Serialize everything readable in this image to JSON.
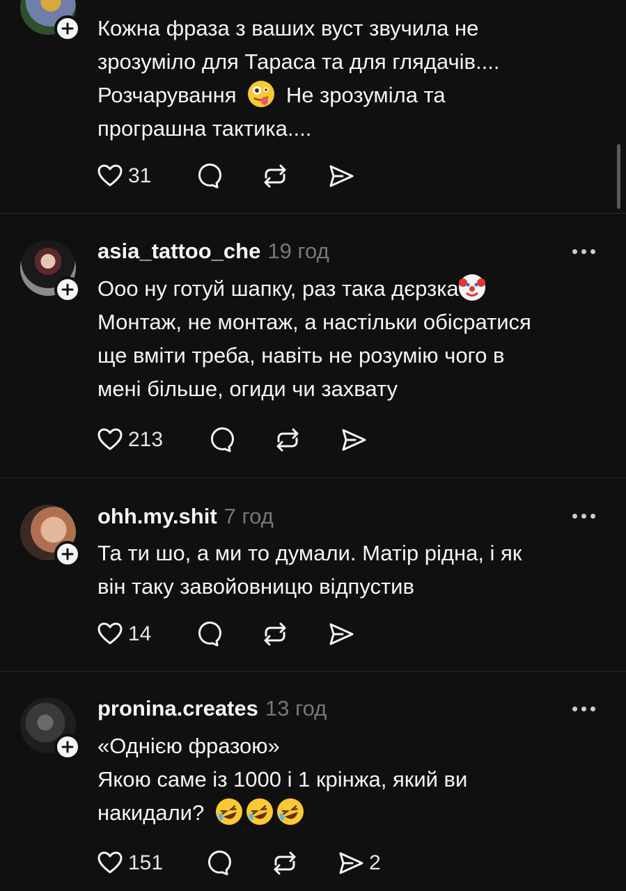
{
  "posts": [
    {
      "username": "",
      "time": "",
      "lines": [
        "Кожна фраза з ваших вуст звучила не",
        "зрозуміло для Тараса та для глядачів....",
        "Розчарування",
        "Не зрозуміла та",
        "програшна тактика...."
      ],
      "likes": "31",
      "shares": ""
    },
    {
      "username": "asia_tattoo_che",
      "time": "19 год",
      "lines": [
        "Ооо ну готуй шапку, раз така дєрзка",
        "Монтаж, не монтаж, а настільки обісратися",
        "ще вміти треба, навіть не розумію чого в",
        "мені більше, огиди чи захвату"
      ],
      "likes": "213",
      "shares": ""
    },
    {
      "username": "ohh.my.shit",
      "time": "7 год",
      "lines": [
        "Та ти шо, а ми то думали. Матір рідна, і як",
        "він таку завойовницю відпустив"
      ],
      "likes": "14",
      "shares": ""
    },
    {
      "username": "pronina.creates",
      "time": "13 год",
      "lines": [
        "«Однією фразою»",
        "Якою саме із 1000 і 1 крінжа, який ви",
        "накидали?"
      ],
      "likes": "151",
      "shares": "2"
    }
  ],
  "icons": {
    "like": "heart-icon",
    "reply": "comment-icon",
    "repost": "repost-icon",
    "share": "share-icon",
    "follow": "plus-icon",
    "more": "more-icon",
    "emoji_zany": "zany-face-emoji",
    "emoji_clown": "clown-face-emoji",
    "emoji_laugh": "rofl-emoji"
  },
  "colors": {
    "background": "#101010",
    "text": "#f3f5f7",
    "secondary": "#777777",
    "divider": "#2a2a2a"
  }
}
